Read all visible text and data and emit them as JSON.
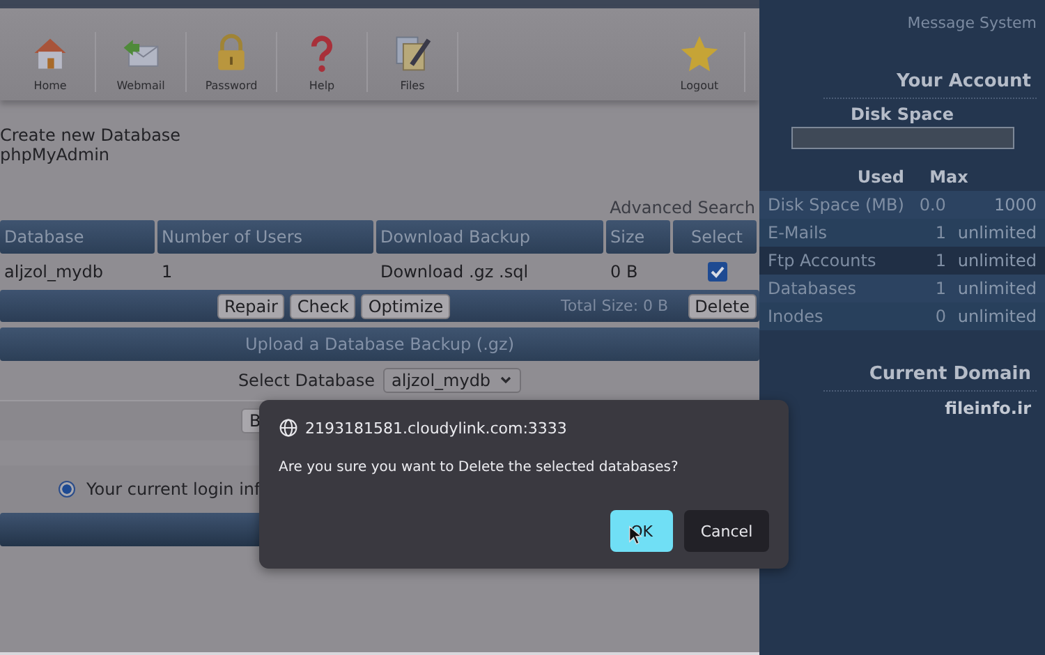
{
  "toolbar": {
    "items": [
      {
        "label": "Home",
        "kind": "home"
      },
      {
        "label": "Webmail",
        "kind": "mail"
      },
      {
        "label": "Password",
        "kind": "lock"
      },
      {
        "label": "Help",
        "kind": "help"
      },
      {
        "label": "Files",
        "kind": "files"
      },
      {
        "label": "Logout",
        "kind": "logout"
      }
    ]
  },
  "links": [
    "Create new Database",
    "phpMyAdmin"
  ],
  "advanced_search": "Advanced Search",
  "table": {
    "columns": [
      "Database",
      "Number of Users",
      "Download Backup",
      "Size",
      "Select"
    ],
    "rows": [
      {
        "cells": [
          "aljzol_mydb",
          "1",
          "Download .gz .sql",
          "0 B"
        ],
        "selected": true
      }
    ]
  },
  "actions": {
    "buttons": [
      "Repair",
      "Check",
      "Optimize"
    ],
    "total": "Total Size: 0 B",
    "delete": "Delete"
  },
  "upload": {
    "title": "Upload a Database Backup (.gz)",
    "select_label": "Select Database",
    "select_value": "aljzol_mydb",
    "partial_button": "B"
  },
  "login_option": {
    "label": "Your current login inf",
    "selected": true
  },
  "sidebar": {
    "message_system": "Message System",
    "account_title": "Your Account",
    "disk_space": {
      "title": "Disk Space",
      "level": 0
    },
    "columns": [
      "Used",
      "Max"
    ],
    "rows": [
      {
        "name": "Disk Space (MB)",
        "used": "0.0",
        "max": "1000"
      },
      {
        "name": "E-Mails",
        "used": "1",
        "max": "unlimited"
      },
      {
        "name": "Ftp Accounts",
        "used": "1",
        "max": "unlimited"
      },
      {
        "name": "Databases",
        "used": "1",
        "max": "unlimited"
      },
      {
        "name": "Inodes",
        "used": "0",
        "max": "unlimited"
      }
    ],
    "domain_title": "Current Domain",
    "domain": "fileinfo.ir"
  },
  "dialog": {
    "origin": "2193181581.cloudylink.com:3333",
    "message": "Are you sure you want to Delete the selected databases?",
    "buttons": [
      {
        "label": "OK",
        "kind": "primary"
      },
      {
        "label": "Cancel",
        "kind": "secondary"
      }
    ]
  }
}
